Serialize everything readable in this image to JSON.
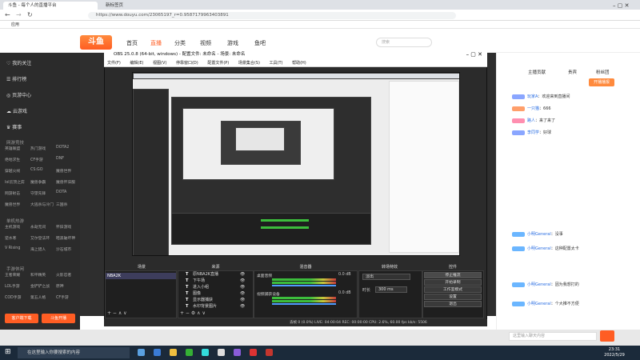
{
  "browser": {
    "tabs": [
      "斗鱼 - 每个人的直播平台",
      "新标签页"
    ],
    "url": "https://www.douyu.com/23065197_r=0.9587179963403891",
    "bookmark": "应用"
  },
  "header": {
    "logo_text": "斗鱼",
    "nav": [
      "首页",
      "直播",
      "分类",
      "视频",
      "游戏",
      "鱼吧"
    ],
    "search_placeholder": "搜索",
    "login_text": "登录"
  },
  "sidebar": {
    "items": [
      {
        "label": "我的关注"
      },
      {
        "label": "排行榜"
      },
      {
        "label": "页游中心"
      },
      {
        "label": "云游戏"
      },
      {
        "label": "赛事"
      }
    ],
    "sections": [
      {
        "title": "网游竞技",
        "rows": [
          [
            "英雄联盟",
            "热门游戏",
            "DOTA2"
          ],
          [
            "绝地求生",
            "CF手游",
            "DNF"
          ],
          [
            "穿越火线",
            "CS:GO",
            "魔兽世界"
          ],
          [
            "lol云顶之弈",
            "魔兽争霸",
            "魔兽怀旧服"
          ],
          [
            "网游射击",
            "守望先锋",
            "DOTA"
          ],
          [
            "魔兽世界",
            "大逃杀与冷门",
            "三国杀"
          ]
        ]
      },
      {
        "title": "单机热游",
        "rows": [
          [
            "主机游戏",
            "永劫无间",
            "怀旧游戏"
          ],
          [
            "逆水寒",
            "艾尔登法环",
            "暗黑破坏神"
          ],
          [
            "V Rising",
            "海上猎人",
            "沙石城市"
          ]
        ]
      },
      {
        "title": "手游休闲",
        "rows": [
          [
            "王者荣耀",
            "和平精英",
            "火影忍者"
          ],
          [
            "LOL手游",
            "金铲铲之战",
            "原神"
          ],
          [
            "COD手游",
            "第五人格",
            "CF手游"
          ]
        ]
      }
    ],
    "buttons": [
      "客户端下载",
      "斗鱼开播"
    ]
  },
  "obs": {
    "title": "OBS 25.0.8 (64-bit, windows) - 配置文件: 未命名 - 场景: 未命名",
    "menu": [
      "文件(F)",
      "编辑(E)",
      "视图(V)",
      "停靠窗口(D)",
      "配置文件(P)",
      "场景集合(S)",
      "工具(T)",
      "帮助(H)"
    ],
    "docks": [
      "场景",
      "来源",
      "混音器",
      "转场特效",
      "控件"
    ],
    "scene": "NBA2K",
    "sources": [
      "原NBA2K直播",
      "下午场",
      "进入小组",
      "图像",
      "显示器捕获",
      "水印背景图片"
    ],
    "mixer": [
      {
        "name": "桌面音频",
        "db": "0.0 dB"
      },
      {
        "name": "视频捕获设备",
        "db": "0.0 dB"
      }
    ],
    "transition": {
      "label": "淡出",
      "duration_label": "时长",
      "duration": "300 ms"
    },
    "controls": [
      "停止推流",
      "开始录制",
      "工作室模式",
      "设置",
      "退出"
    ],
    "status": "丢帧 0 (0.0%)   LIVE: 04:00:04   REC: 00:00:00   CPU: 2.6%, 60.00 fps   kb/s: 5506"
  },
  "right_panel": {
    "tabs": [
      "主播贡献",
      "贵宾",
      "粉丝团"
    ],
    "banner": "开播播报",
    "chat": [
      {
        "name": "玩家A",
        "text": "欢迎来到直播间"
      },
      {
        "name": "一只猫",
        "text": "666"
      },
      {
        "name": "路人",
        "text": "来了来了"
      },
      {
        "name": "李同学",
        "text": "好球"
      },
      {
        "name": "小明General",
        "text": "没事"
      },
      {
        "name": "小明General",
        "text": "这种配置太卡"
      },
      {
        "name": "小明General",
        "text": "因为我想打的"
      },
      {
        "name": "小明General",
        "text": "个大推不方便"
      }
    ],
    "input_placeholder": "这里输入聊天内容",
    "send_label": "发送"
  },
  "taskbar": {
    "search_placeholder": "在这里输入你要搜索的内容",
    "time": "23:31",
    "date": "2022/5/29"
  },
  "colors": {
    "accent": "#ff5d23",
    "sidebar": "#2b2b2b",
    "obs_bg": "#2b2b2b",
    "taskbar": "#1b2a3a"
  }
}
